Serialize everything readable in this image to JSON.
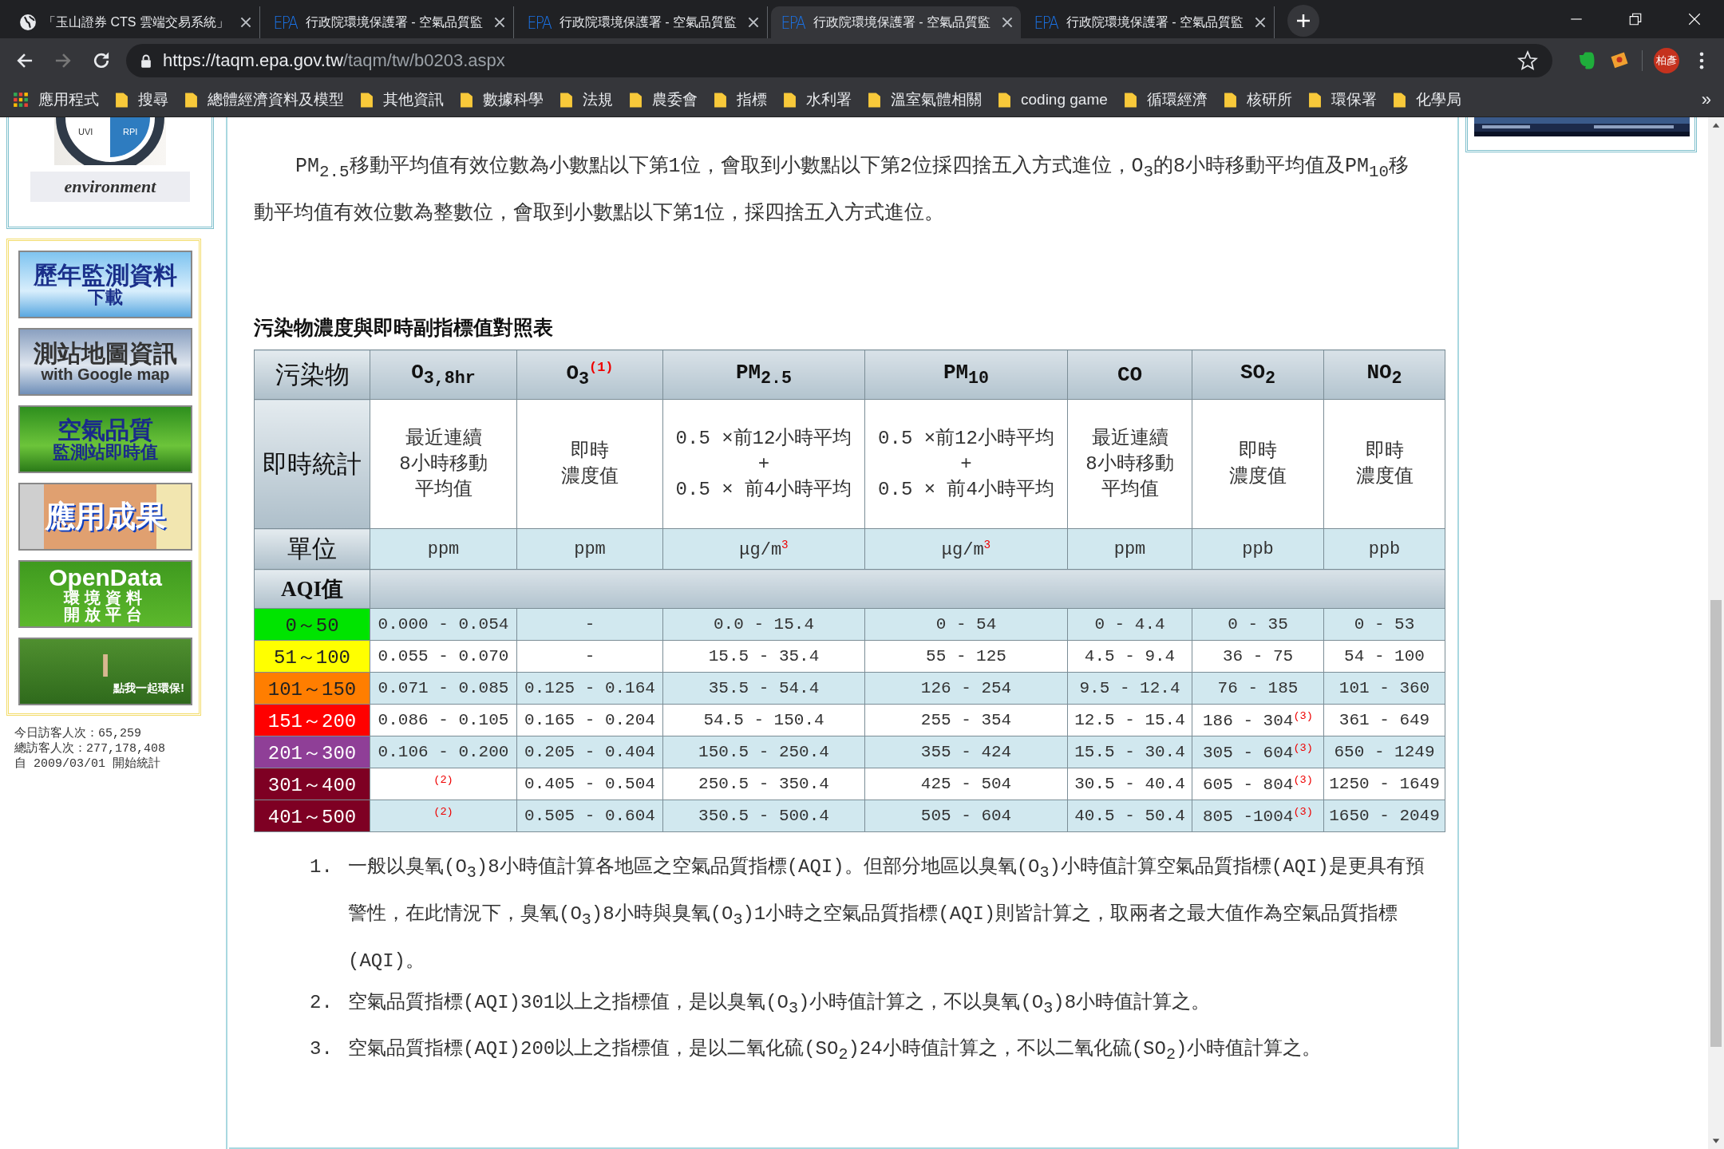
{
  "browser": {
    "tabs": [
      {
        "kind": "globe",
        "title": "「玉山證券 CTS 雲端交易系統」",
        "selected": false
      },
      {
        "kind": "site",
        "logo_text": "EPA",
        "title": "行政院環境保護署 - 空氣品質監",
        "selected": false
      },
      {
        "kind": "site",
        "logo_text": "EPA",
        "title": "行政院環境保護署 - 空氣品質監",
        "selected": false
      },
      {
        "kind": "site",
        "logo_text": "EPA",
        "title": "行政院環境保護署 - 空氣品質監",
        "selected": true
      },
      {
        "kind": "site",
        "logo_text": "EPA",
        "title": "行政院環境保護署 - 空氣品質監",
        "selected": false
      }
    ],
    "nav": {
      "back": {
        "disabled": false
      },
      "forward": {
        "disabled": true
      }
    },
    "url": {
      "host": "https://taqm.epa.gov.tw",
      "path": "/taqm/tw/b0203.aspx"
    },
    "profile": "柏彥",
    "apps_label": "應用程式",
    "bookmarks": [
      "搜尋",
      "總體經濟資料及模型",
      "其他資訊",
      "數據科學",
      "法規",
      "農委會",
      "指標",
      "水利署",
      "溫室氣體相關",
      "coding game",
      "循環經濟",
      "核研所",
      "環保署",
      "化學局"
    ],
    "overflow": "»"
  },
  "sidebar": {
    "logo": {
      "gauge_left": "UVI",
      "gauge_right": "RPI",
      "word": "environment"
    },
    "banners": [
      {
        "kind": "sky",
        "lines": [
          "歷年監測資料",
          "下載"
        ]
      },
      {
        "kind": "map",
        "lines": [
          "測站地圖資訊",
          "with Google map"
        ]
      },
      {
        "kind": "palm",
        "lines": [
          "空氣品質",
          "監測站即時值"
        ]
      },
      {
        "kind": "pencil",
        "lines": [
          "應用成果"
        ]
      },
      {
        "kind": "opendata",
        "lines": [
          "OpenData",
          "環境資料",
          "開放平台"
        ]
      },
      {
        "kind": "love",
        "lines": [
          "I",
          "點我一起環保!"
        ]
      }
    ],
    "stats": [
      "今日訪客人次：65,259",
      "總訪客人次：277,178,408",
      "自 2009/03/01 開始統計"
    ]
  },
  "intro": "PM$_{2.5}$移動平均值有效位數為小數點以下第1位，會取到小數點以下第2位採四捨五入方式進位，O$_{3}$的8小時移動平均值及PM$_{10}$移動平均值有效位數為整數位，會取到小數點以下第1位，採四捨五入方式進位。",
  "table": {
    "title": "污染物濃度與即時副指標值對照表",
    "pollutant_label": "污染物",
    "columns": [
      "O$_{3,8hr}$",
      "O$_{3}$$^{(1)}$",
      "PM$_{2.5}$",
      "PM$_{10}$",
      "CO",
      "SO$_{2}$",
      "NO$_{2}$"
    ],
    "stat_label": "即時統計",
    "stats": [
      [
        "最近連續",
        "8小時移動",
        "平均值"
      ],
      [
        "即時",
        "濃度值"
      ],
      [
        "0.5 ×前12小時平均",
        "+",
        "0.5 × 前4小時平均"
      ],
      [
        "0.5 ×前12小時平均",
        "+",
        "0.5 × 前4小時平均"
      ],
      [
        "最近連續",
        "8小時移動",
        "平均值"
      ],
      [
        "即時",
        "濃度值"
      ],
      [
        "即時",
        "濃度值"
      ]
    ],
    "unit_label": "單位",
    "units": [
      "ppm",
      "ppm",
      "μg/m$^{3}$",
      "μg/m$^{3}$",
      "ppm",
      "ppb",
      "ppb"
    ],
    "aqi_label": "AQI值",
    "rows": [
      {
        "range": "0～50",
        "color": "#00e400",
        "cells": [
          "0.000 - 0.054",
          "-",
          "0.0 - 15.4",
          "0 - 54",
          "0 - 4.4",
          "0 - 35",
          "0 - 53"
        ]
      },
      {
        "range": "51～100",
        "color": "#ffff00",
        "cells": [
          "0.055 - 0.070",
          "-",
          "15.5 - 35.4",
          "55 - 125",
          "4.5 - 9.4",
          "36 - 75",
          "54 - 100"
        ]
      },
      {
        "range": "101～150",
        "color": "#ff7e00",
        "cells": [
          "0.071 - 0.085",
          "0.125 - 0.164",
          "35.5 - 54.4",
          "126 - 254",
          "9.5 - 12.4",
          "76 - 185",
          "101 - 360"
        ]
      },
      {
        "range": "151～200",
        "color": "#ff0000",
        "cells": [
          "0.086 - 0.105",
          "0.165 - 0.204",
          "54.5 - 150.4",
          "255 - 354",
          "12.5 - 15.4",
          "186 - 304$^{(3)}$",
          "361 - 649"
        ]
      },
      {
        "range": "201～300",
        "color": "#8f3f97",
        "cells": [
          "0.106 - 0.200",
          "0.205 - 0.404",
          "150.5 - 250.4",
          "355 - 424",
          "15.5 - 30.4",
          "305 - 604$^{(3)}$",
          "650 - 1249"
        ]
      },
      {
        "range": "301～400",
        "color": "#7e0023",
        "cells": [
          "$^{(2)}$",
          "0.405 - 0.504",
          "250.5 - 350.4",
          "425 - 504",
          "30.5 - 40.4",
          "605 - 804$^{(3)}$",
          "1250 - 1649"
        ]
      },
      {
        "range": "401～500",
        "color": "#7e0023",
        "cells": [
          "$^{(2)}$",
          "0.505 - 0.604",
          "350.5 - 500.4",
          "505 - 604",
          "40.5 - 50.4",
          "805 -1004$^{(3)}$",
          "1650 - 2049"
        ]
      }
    ]
  },
  "notes": [
    {
      "number": "1.",
      "text": "一般以臭氧(O$_{3}$)8小時值計算各地區之空氣品質指標(AQI)。但部分地區以臭氧(O$_{3}$)小時值計算空氣品質指標(AQI)是更具有預警性，在此情況下，臭氧(O$_{3}$)8小時與臭氧(O$_{3}$)1小時之空氣品質指標(AQI)則皆計算之，取兩者之最大值作為空氣品質指標(AQI)。"
    },
    {
      "number": "2.",
      "text": "空氣品質指標(AQI)301以上之指標值，是以臭氧(O$_{3}$)小時值計算之，不以臭氧(O$_{3}$)8小時值計算之。"
    },
    {
      "number": "3.",
      "text": "空氣品質指標(AQI)200以上之指標值，是以二氧化硫(SO$_{2}$)24小時值計算之，不以二氧化硫(SO$_{2}$)小時值計算之。"
    }
  ]
}
